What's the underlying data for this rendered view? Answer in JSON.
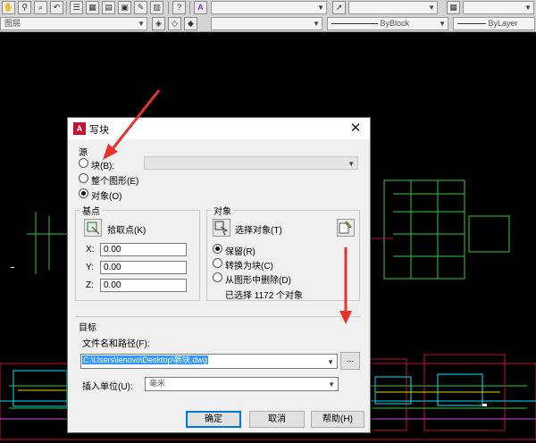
{
  "toolbar": {
    "row1_icons": [
      "pan-icon",
      "zoom-realtime-icon",
      "zoom-window-icon",
      "zoom-previous-icon",
      "properties-icon",
      "design-center-icon",
      "tool-palettes-icon",
      "sheet-set-icon",
      "markup-icon",
      "calculator-icon",
      "help-icon",
      "text-style-icon",
      "dim-style-icon",
      "table-style-icon"
    ],
    "help_glyph": "?",
    "text_style_glyph": "A",
    "layer_label": "图层",
    "linetype_value": "ByBlock",
    "lineweight_value": "ByLayer"
  },
  "dialog": {
    "title": "写块",
    "close_glyph": "✕",
    "source": {
      "label": "源",
      "option_block": "块(B):",
      "option_whole": "整个图形(E)",
      "option_objects": "对象(O)",
      "selected": "objects"
    },
    "base_point": {
      "label": "基点",
      "pick_label": "拾取点(K)",
      "x_label": "X:",
      "y_label": "Y:",
      "z_label": "Z:",
      "x_value": "0.00",
      "y_value": "0.00",
      "z_value": "0.00"
    },
    "objects": {
      "label": "对象",
      "select_label": "选择对象(T)",
      "retain": "保留(R)",
      "convert": "转换为块(C)",
      "delete": "从图形中删除(D)",
      "selected_option": "retain",
      "count_text": "已选择 1172 个对象"
    },
    "destination": {
      "label": "目标",
      "path_label": "文件名和路径(F):",
      "path_value": "C:\\Users\\lenovo\\Desktop\\新块.dwg",
      "browse_label": "...",
      "units_label": "插入单位(U):",
      "units_value": "毫米"
    },
    "buttons": {
      "ok": "确定",
      "cancel": "取消",
      "help": "帮助(H)"
    }
  },
  "colors": {
    "canvas_bg": "#000000",
    "cad_green": "#2ecc40",
    "cad_red": "#c8102e",
    "cad_cyan": "#00e5ff",
    "annotation_arrow": "#e8322b",
    "selection_highlight": "#3399ff"
  }
}
